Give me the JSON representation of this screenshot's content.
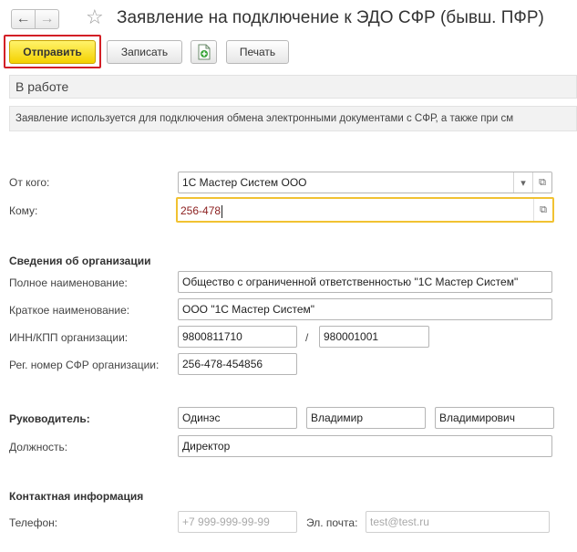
{
  "window": {
    "title": "Заявление на подключение к ЭДО СФР (бывш. ПФР)",
    "back_icon": "arrow-left-icon",
    "forward_icon": "arrow-right-icon",
    "favorite_icon": "star-icon"
  },
  "toolbar": {
    "send_label": "Отправить",
    "save_label": "Записать",
    "print_label": "Печать",
    "add_icon": "add-document-icon"
  },
  "status": "В работе",
  "info_text": "Заявление используется для подключения обмена электронными документами с СФР, а также при см",
  "from": {
    "label": "От кого:",
    "value": "1С Мастер Систем ООО"
  },
  "to": {
    "label": "Кому:",
    "value": "256-478"
  },
  "org": {
    "section_title": "Сведения об организации",
    "full_name_label": "Полное наименование:",
    "full_name": "Общество с ограниченной ответственностью \"1С Мастер Систем\"",
    "short_name_label": "Краткое наименование:",
    "short_name": "ООО \"1С Мастер Систем\"",
    "inn_kpp_label": "ИНН/КПП организации:",
    "inn": "9800811710",
    "separator": "/",
    "kpp": "980001001",
    "reg_label": "Рег. номер СФР организации:",
    "reg_number": "256-478-454856"
  },
  "head": {
    "label": "Руководитель:",
    "last_name": "Одинэс",
    "first_name": "Владимир",
    "middle_name": "Владимирович",
    "position_label": "Должность:",
    "position": "Директор"
  },
  "contact": {
    "section_title": "Контактная информация",
    "phone_label": "Телефон:",
    "phone_placeholder": "+7 999-999-99-99",
    "email_label": "Эл. почта:",
    "email_placeholder": "test@test.ru"
  }
}
